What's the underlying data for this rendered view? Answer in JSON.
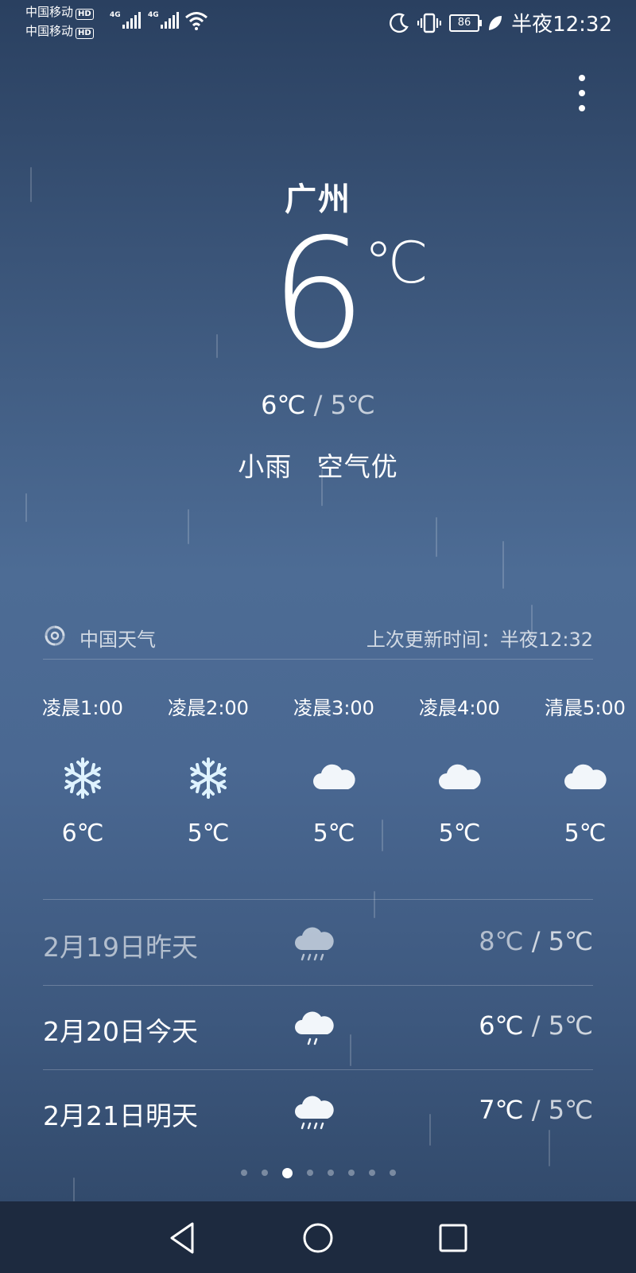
{
  "status_bar": {
    "carrier_1": "中国移动",
    "carrier_2": "中国移动",
    "hd": "HD",
    "network_1": "4G",
    "network_2": "4G",
    "battery": "86",
    "time": "半夜12:32",
    "icons": [
      "moon-icon",
      "vibrate-icon",
      "battery-icon",
      "leaf-icon",
      "wifi-icon"
    ]
  },
  "current": {
    "city": "广州",
    "temp": "6",
    "unit": "℃",
    "high": "6℃",
    "separator": "/",
    "low": "5℃",
    "condition": "小雨",
    "air": "空气优"
  },
  "source": {
    "name": "中国天气",
    "updated": "上次更新时间：半夜12:32"
  },
  "hourly": [
    {
      "time": "凌晨1:00",
      "icon": "snowflake-icon",
      "temp": "6℃"
    },
    {
      "time": "凌晨2:00",
      "icon": "snowflake-icon",
      "temp": "5℃"
    },
    {
      "time": "凌晨3:00",
      "icon": "cloud-icon",
      "temp": "5℃"
    },
    {
      "time": "凌晨4:00",
      "icon": "cloud-icon",
      "temp": "5℃"
    },
    {
      "time": "清晨5:00",
      "icon": "cloud-icon",
      "temp": "5℃"
    }
  ],
  "daily": [
    {
      "date": "2月19日昨天",
      "icon": "rain-cloud-icon",
      "high": "8℃",
      "sep": "/",
      "low": "5℃"
    },
    {
      "date": "2月20日今天",
      "icon": "light-rain-cloud-icon",
      "high": "6℃",
      "sep": "/",
      "low": "5℃"
    },
    {
      "date": "2月21日明天",
      "icon": "rain-cloud-icon",
      "high": "7℃",
      "sep": "/",
      "low": "5℃"
    }
  ],
  "pager": {
    "count": 8,
    "active": 3
  },
  "colors": {
    "background_top": "#2a4060",
    "background_mid": "#4d6c95",
    "navbar": "#1d2a3f"
  }
}
